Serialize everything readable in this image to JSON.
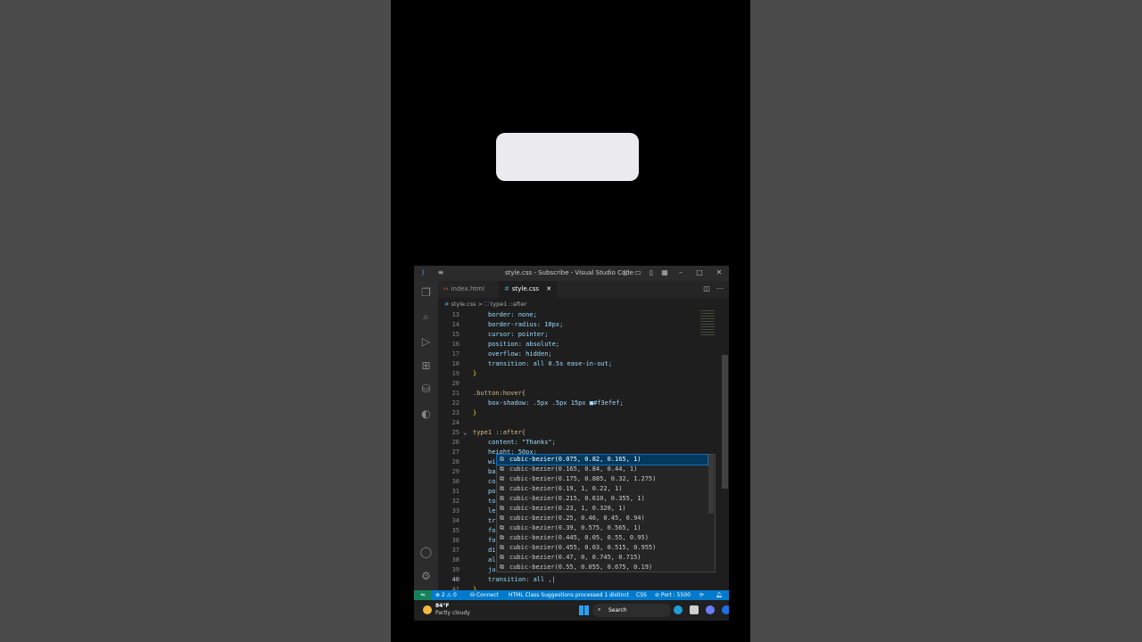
{
  "window": {
    "title": "style.css - Subscribe - Visual Studio Code"
  },
  "tabs": [
    {
      "label": "index.html"
    },
    {
      "label": "style.css",
      "close": "✕"
    }
  ],
  "breadcrumb": {
    "file": "style.css",
    "separator": ">",
    "symbol": "type1 ::after"
  },
  "lines": [
    {
      "n": "13",
      "text": "border: none;"
    },
    {
      "n": "14",
      "text": "border-radius: 10px;"
    },
    {
      "n": "15",
      "text": "cursor: pointer;"
    },
    {
      "n": "16",
      "text": "position: absolute;"
    },
    {
      "n": "17",
      "text": "overflow: hidden;"
    },
    {
      "n": "18",
      "text": "transition: all 0.5s ease-in-out;"
    },
    {
      "n": "19",
      "text": "}"
    },
    {
      "n": "20",
      "text": ""
    },
    {
      "n": "21",
      "text": ".button:hover{"
    },
    {
      "n": "22",
      "text": "box-shadow: .5px .5px 15px ■#f3efef;"
    },
    {
      "n": "23",
      "text": "}"
    },
    {
      "n": "24",
      "text": ""
    },
    {
      "n": "25",
      "text": "type1 ::after{"
    },
    {
      "n": "26",
      "text": "content: \"Thanks\";"
    },
    {
      "n": "27",
      "text": "height: 50px;"
    },
    {
      "n": "28",
      "text": "wi"
    },
    {
      "n": "29",
      "text": "ba"
    },
    {
      "n": "30",
      "text": "co"
    },
    {
      "n": "31",
      "text": "po"
    },
    {
      "n": "32",
      "text": "to"
    },
    {
      "n": "33",
      "text": "le"
    },
    {
      "n": "34",
      "text": "tr"
    },
    {
      "n": "35",
      "text": "fo"
    },
    {
      "n": "36",
      "text": "fo"
    },
    {
      "n": "37",
      "text": "di"
    },
    {
      "n": "38",
      "text": "al"
    },
    {
      "n": "39",
      "text": "ju"
    },
    {
      "n": "40",
      "text": "transition: all ,|"
    },
    {
      "n": "41",
      "text": "}"
    }
  ],
  "suggestions": [
    "cubic-bezier(0.075, 0.82, 0.165, 1)",
    "cubic-bezier(0.165, 0.84, 0.44, 1)",
    "cubic-bezier(0.175, 0.885, 0.32, 1.275)",
    "cubic-bezier(0.19, 1, 0.22, 1)",
    "cubic-bezier(0.215, 0.610, 0.355, 1)",
    "cubic-bezier(0.23, 1, 0.320, 1)",
    "cubic-bezier(0.25, 0.46, 0.45, 0.94)",
    "cubic-bezier(0.39, 0.575, 0.565, 1)",
    "cubic-bezier(0.445, 0.05, 0.55, 0.95)",
    "cubic-bezier(0.455, 0.03, 0.515, 0.955)",
    "cubic-bezier(0.47, 0, 0.745, 0.715)",
    "cubic-bezier(0.55, 0.055, 0.675, 0.19)"
  ],
  "statusbar": {
    "problems": "⊗ 2 ⚠ 0",
    "connect": "Connect",
    "message": "HTML Class Suggestions processed 1 distinct",
    "language": "CSS",
    "port": "⊘ Port : 5500"
  },
  "taskbar": {
    "temperature": "84°F",
    "weather": "Partly cloudy",
    "search": "Search"
  },
  "colors": {
    "accent": "#007acc",
    "suggestion_highlight": "#04395e",
    "preview_button": "#ebebef"
  }
}
